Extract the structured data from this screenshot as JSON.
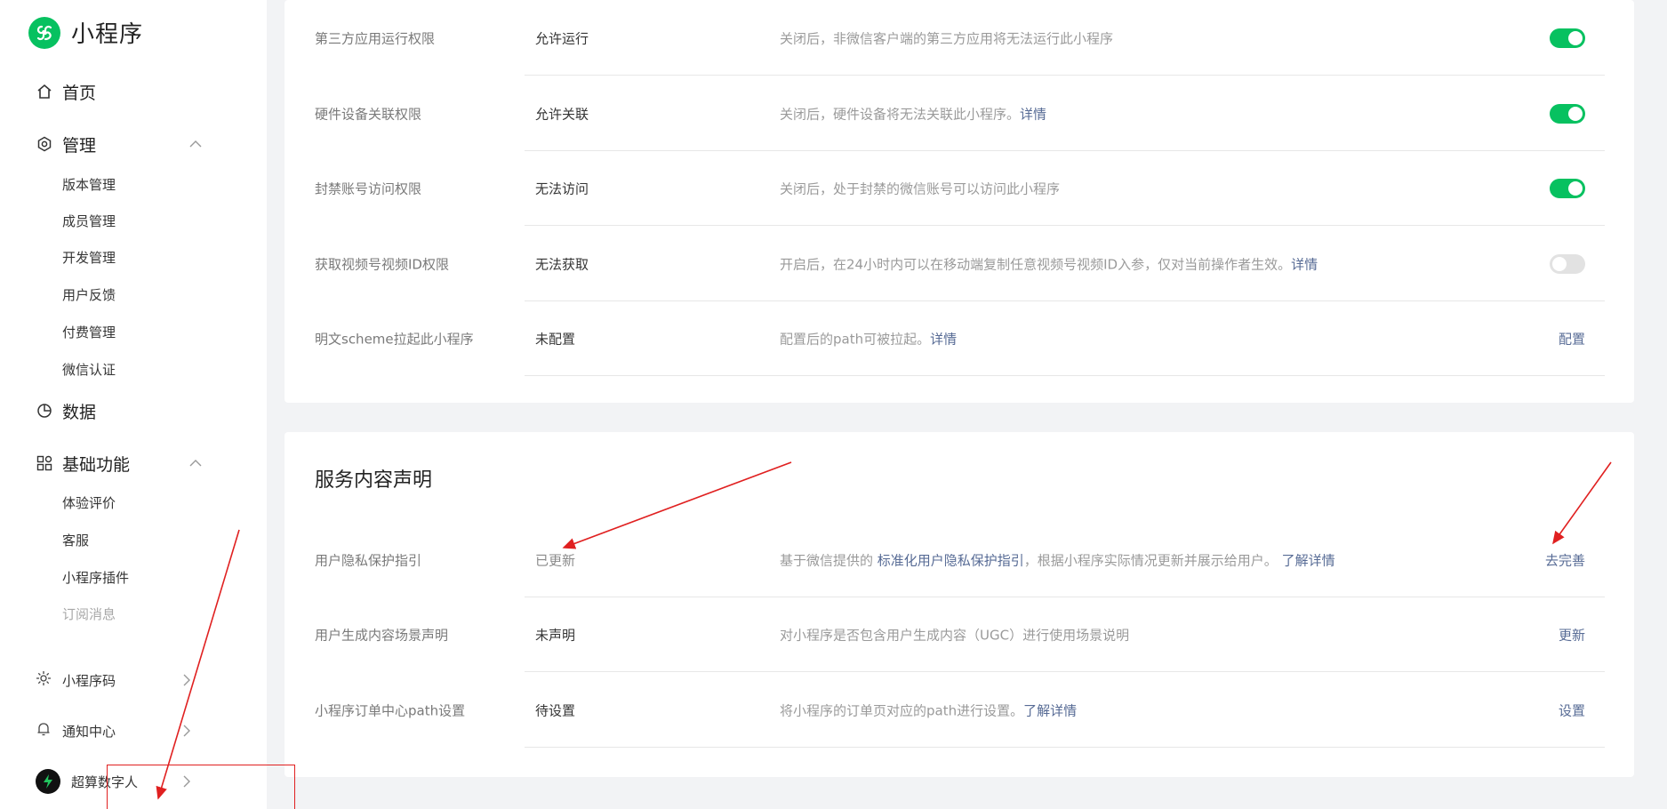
{
  "brand": {
    "title": "小程序",
    "color": "#07c160"
  },
  "sidebar": {
    "home": {
      "label": "首页",
      "icon": "home-icon"
    },
    "manage": {
      "label": "管理",
      "icon": "settings-hexagon-icon",
      "items": [
        "版本管理",
        "成员管理",
        "开发管理",
        "用户反馈",
        "付费管理",
        "微信认证"
      ]
    },
    "data": {
      "label": "数据",
      "icon": "pie-chart-icon"
    },
    "basic": {
      "label": "基础功能",
      "icon": "grid-icon",
      "items": [
        "体验评价",
        "客服",
        "小程序插件",
        "订阅消息"
      ]
    },
    "bottom": [
      {
        "label": "小程序码",
        "icon": "sun-icon"
      },
      {
        "label": "通知中心",
        "icon": "bell-icon"
      },
      {
        "label": "超算数字人",
        "icon": "avatar-icon"
      }
    ]
  },
  "settings": {
    "rows": [
      {
        "name": "第三方应用运行权限",
        "status": "允许运行",
        "desc": "关闭后，非微信客户端的第三方应用将无法运行此小程序",
        "link": "",
        "control": "toggle",
        "on": true
      },
      {
        "name": "硬件设备关联权限",
        "status": "允许关联",
        "desc": "关闭后，硬件设备将无法关联此小程序。",
        "link": "详情",
        "control": "toggle",
        "on": true
      },
      {
        "name": "封禁账号访问权限",
        "status": "无法访问",
        "desc": "关闭后，处于封禁的微信账号可以访问此小程序",
        "link": "",
        "control": "toggle",
        "on": true
      },
      {
        "name": "获取视频号视频ID权限",
        "status": "无法获取",
        "desc": "开启后，在24小时内可以在移动端复制任意视频号视频ID入参，仅对当前操作者生效。",
        "link": "详情",
        "control": "toggle",
        "on": false
      },
      {
        "name": "明文scheme拉起此小程序",
        "status": "未配置",
        "desc": "配置后的path可被拉起。",
        "link": "详情",
        "control": "action",
        "action": "配置"
      }
    ]
  },
  "service": {
    "title": "服务内容声明",
    "privacy": {
      "name": "用户隐私保护指引",
      "status": "已更新",
      "desc_prefix": "基于微信提供的 ",
      "desc_link": "标准化用户隐私保护指引",
      "desc_suffix": "，根据小程序实际情况更新并展示给用户。 ",
      "desc_link2": "了解详情",
      "action": "去完善"
    },
    "ugc": {
      "name": "用户生成内容场景声明",
      "status": "未声明",
      "desc": "对小程序是否包含用户生成内容（UGC）进行使用场景说明",
      "action": "更新"
    },
    "order": {
      "name": "小程序订单中心path设置",
      "status": "待设置",
      "desc": "将小程序的订单页对应的path进行设置。",
      "link": "了解详情",
      "action": "设置"
    }
  },
  "annotations": {
    "color": "#e02020"
  }
}
